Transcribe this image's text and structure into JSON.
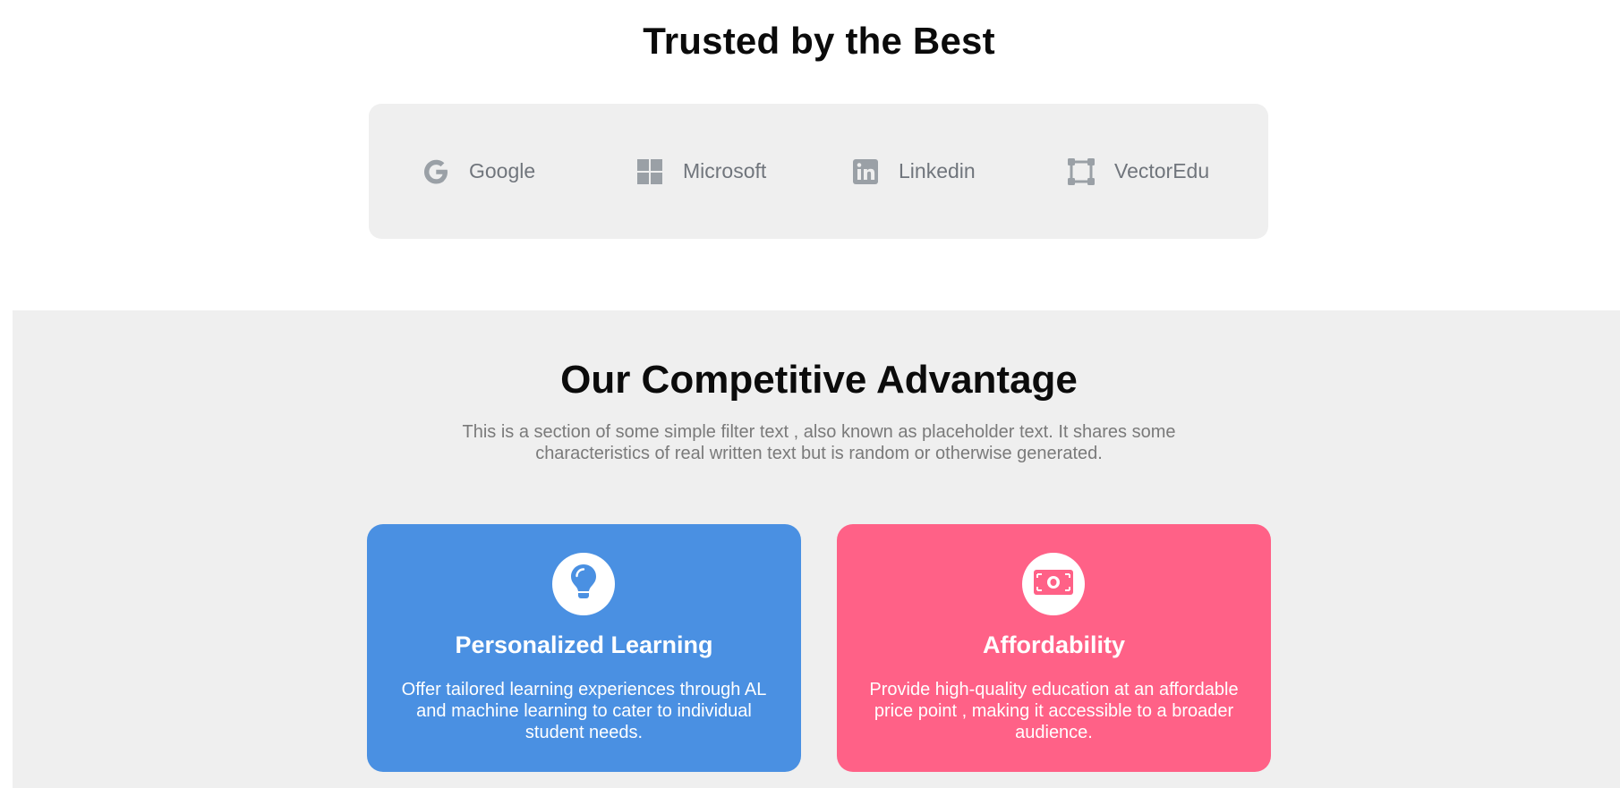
{
  "trusted": {
    "title": "Trusted by the Best",
    "logos": [
      {
        "name": "Google",
        "icon": "google-icon"
      },
      {
        "name": "Microsoft",
        "icon": "microsoft-icon"
      },
      {
        "name": "Linkedin",
        "icon": "linkedin-icon"
      },
      {
        "name": "VectorEdu",
        "icon": "vector-square-icon"
      }
    ],
    "logo_color": "#9aa0a6"
  },
  "advantage": {
    "title": "Our Competitive Advantage",
    "subtitle": "This is a section of some simple filter text , also known as placeholder text. It shares some characteristics of real written text but is random or otherwise generated.",
    "cards": [
      {
        "title": "Personalized Learning",
        "text": "Offer tailored learning experiences through AL and machine learning to cater to individual student needs.",
        "icon": "lightbulb-icon",
        "color": "#4a90e2"
      },
      {
        "title": "Affordability",
        "text": "Provide high-quality education at an affordable price point , making it accessible to a broader audience.",
        "icon": "money-bill-icon",
        "color": "#ff6187"
      }
    ]
  }
}
